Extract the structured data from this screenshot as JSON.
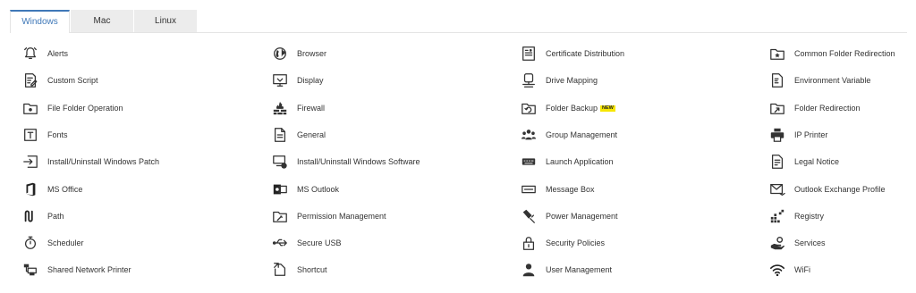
{
  "tabs": [
    {
      "label": "Windows",
      "active": true
    },
    {
      "label": "Mac",
      "active": false
    },
    {
      "label": "Linux",
      "active": false
    }
  ],
  "colors": {
    "accent": "#3f78b8",
    "tab_inactive_bg": "#ececec",
    "new_badge": "#f7e600"
  },
  "columns": [
    [
      {
        "label": "Alerts",
        "icon": "alarm-icon"
      },
      {
        "label": "Custom Script",
        "icon": "script-icon"
      },
      {
        "label": "File Folder Operation",
        "icon": "folder-gear-icon"
      },
      {
        "label": "Fonts",
        "icon": "font-icon"
      },
      {
        "label": "Install/Uninstall Windows Patch",
        "icon": "install-patch-icon"
      },
      {
        "label": "MS Office",
        "icon": "ms-office-icon"
      },
      {
        "label": "Path",
        "icon": "path-icon"
      },
      {
        "label": "Scheduler",
        "icon": "stopwatch-icon"
      },
      {
        "label": "Shared Network Printer",
        "icon": "network-printer-icon"
      }
    ],
    [
      {
        "label": "Browser",
        "icon": "globe-icon"
      },
      {
        "label": "Display",
        "icon": "monitor-icon"
      },
      {
        "label": "Firewall",
        "icon": "firewall-icon"
      },
      {
        "label": "General",
        "icon": "document-icon"
      },
      {
        "label": "Install/Uninstall Windows Software",
        "icon": "install-software-icon"
      },
      {
        "label": "MS Outlook",
        "icon": "ms-outlook-icon"
      },
      {
        "label": "Permission Management",
        "icon": "folder-key-icon"
      },
      {
        "label": "Secure USB",
        "icon": "usb-icon"
      },
      {
        "label": "Shortcut",
        "icon": "shortcut-icon"
      }
    ],
    [
      {
        "label": "Certificate Distribution",
        "icon": "certificate-icon"
      },
      {
        "label": "Drive Mapping",
        "icon": "drive-icon"
      },
      {
        "label": "Folder Backup",
        "icon": "folder-backup-icon",
        "badge": "NEW"
      },
      {
        "label": "Group Management",
        "icon": "group-icon"
      },
      {
        "label": "Launch Application",
        "icon": "keyboard-icon"
      },
      {
        "label": "Message Box",
        "icon": "message-box-icon"
      },
      {
        "label": "Power Management",
        "icon": "power-plug-icon"
      },
      {
        "label": "Security Policies",
        "icon": "lock-icon"
      },
      {
        "label": "User Management",
        "icon": "user-icon"
      }
    ],
    [
      {
        "label": "Common Folder Redirection",
        "icon": "folder-star-icon"
      },
      {
        "label": "Environment Variable",
        "icon": "environment-file-icon"
      },
      {
        "label": "Folder Redirection",
        "icon": "folder-arrow-icon"
      },
      {
        "label": "IP Printer",
        "icon": "printer-icon"
      },
      {
        "label": "Legal Notice",
        "icon": "legal-document-icon"
      },
      {
        "label": "Outlook Exchange Profile",
        "icon": "mail-exchange-icon"
      },
      {
        "label": "Registry",
        "icon": "registry-icon"
      },
      {
        "label": "Services",
        "icon": "services-hand-icon"
      },
      {
        "label": "WiFi",
        "icon": "wifi-icon"
      }
    ]
  ]
}
